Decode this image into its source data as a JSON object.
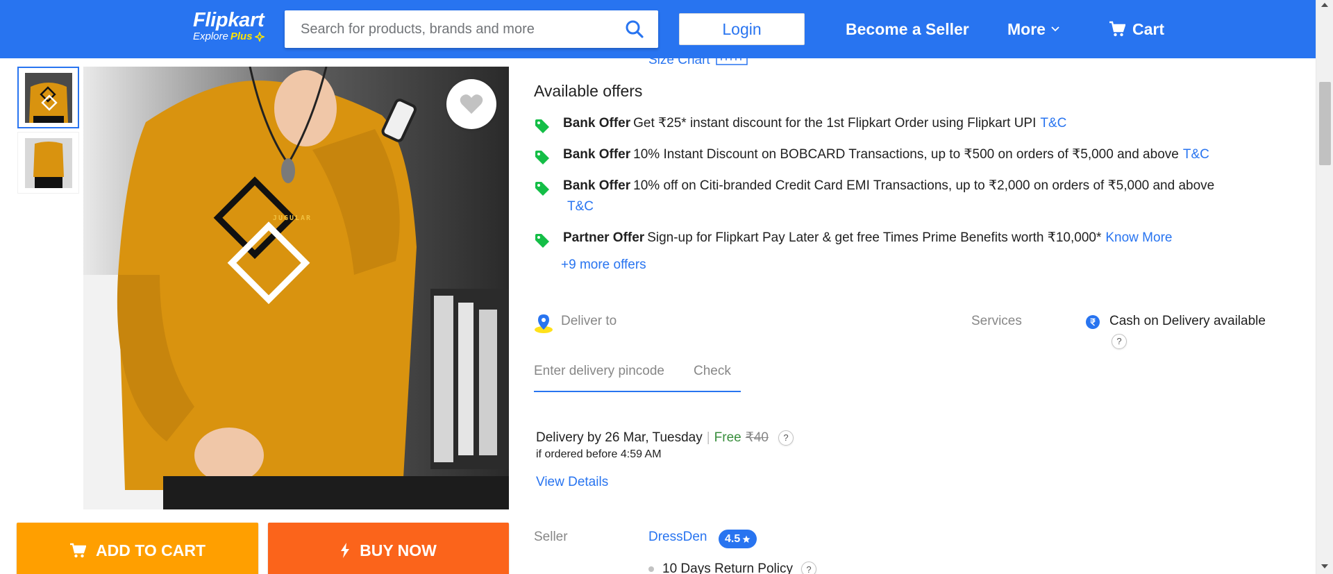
{
  "header": {
    "logo_text": "Flipkart",
    "logo_tagline": "Explore",
    "logo_plus": "Plus",
    "search_placeholder": "Search for products, brands and more",
    "login_label": "Login",
    "seller_label": "Become a Seller",
    "more_label": "More",
    "cart_label": "Cart",
    "brand_color": "#2874f0"
  },
  "product": {
    "print_text": "JUGULAR",
    "shirt_color": "#d9930f",
    "add_to_cart_label": "ADD TO CART",
    "buy_now_label": "BUY NOW"
  },
  "size_chart_label": "Size Chart",
  "offers": {
    "title": "Available offers",
    "items": [
      {
        "kind": "Bank Offer",
        "text": "Get ₹25* instant discount for the 1st Flipkart Order using Flipkart UPI",
        "link": "T&C"
      },
      {
        "kind": "Bank Offer",
        "text": "10% Instant Discount on BOBCARD Transactions, up to ₹500 on orders of ₹5,000 and above",
        "link": "T&C"
      },
      {
        "kind": "Bank Offer",
        "text": "10% off on Citi-branded Credit Card EMI Transactions, up to ₹2,000 on orders of ₹5,000 and above",
        "link": "T&C"
      },
      {
        "kind": "Partner Offer",
        "text": "Sign-up for Flipkart Pay Later & get free Times Prime Benefits worth ₹10,000*",
        "link": "Know More"
      }
    ],
    "more_label": "+9 more offers"
  },
  "delivery": {
    "deliver_to_label": "Deliver to",
    "pincode_placeholder": "Enter delivery pincode",
    "check_label": "Check",
    "services_label": "Services",
    "cod_text": "Cash on Delivery available",
    "date_text": "Delivery by 26 Mar, Tuesday",
    "separator": "|",
    "free_text": "Free",
    "original_fee": "₹40",
    "cutoff_text": "if ordered before 4:59 AM",
    "view_details_label": "View Details",
    "help_glyph": "?"
  },
  "seller": {
    "label": "Seller",
    "name": "DressDen",
    "rating": "4.5",
    "policy": "10 Days Return Policy"
  }
}
